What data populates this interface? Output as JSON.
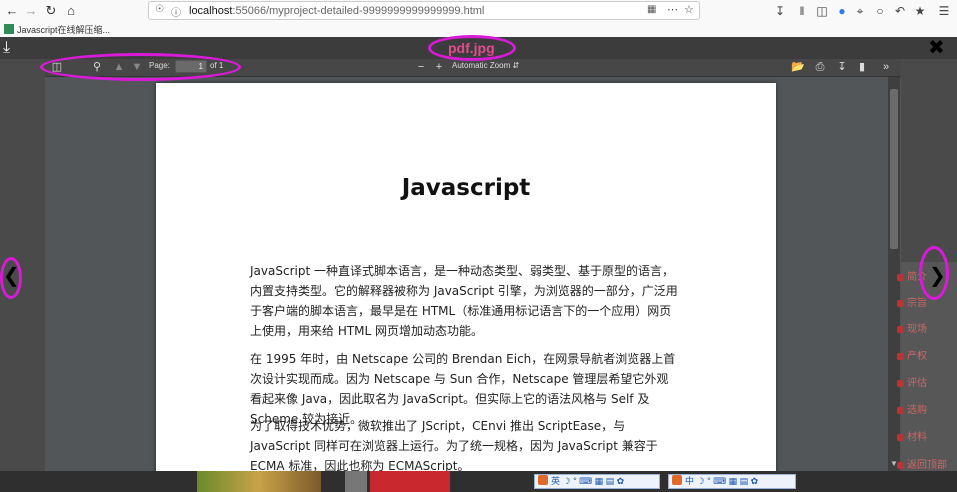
{
  "browser": {
    "url_host": "localhost",
    "url_path": ":55066/myproject-detailed-9999999999999999.html",
    "bookmark": "Javascript在线解压缩..."
  },
  "lightbox": {
    "title": "pdf.jpg",
    "accent_color": "#e34b8f",
    "highlight_color": "#d91bd9"
  },
  "pdf_toolbar": {
    "page_label": "Page:",
    "page_value": "1",
    "page_of": "of 1",
    "zoom_minus": "−",
    "zoom_plus": "+",
    "zoom": "Automatic Zoom",
    "more": "»"
  },
  "document": {
    "title": "Javascript",
    "paragraphs": [
      "JavaScript 一种直译式脚本语言，是一种动态类型、弱类型、基于原型的语言，内置支持类型。它的解释器被称为 JavaScript 引擎，为浏览器的一部分，广泛用于客户端的脚本语言，最早是在 HTML（标准通用标记语言下的一个应用）网页上使用，用来给 HTML 网页增加动态功能。",
      "在 1995 年时，由 Netscape 公司的 Brendan Eich，在网景导航者浏览器上首次设计实现而成。因为 Netscape 与 Sun 合作，Netscape 管理层希望它外观看起来像 Java，因此取名为 JavaScript。但实际上它的语法风格与 Self 及 Scheme 较为接近。",
      "为了取得技术优势，微软推出了 JScript，CEnvi 推出 ScriptEase，与 JavaScript 同样可在浏览器上运行。为了统一规格，因为 JavaScript 兼容于 ECMA 标准，因此也称为 ECMAScript。"
    ]
  },
  "side_panel": {
    "items": [
      "简介",
      "宗旨",
      "现场",
      "产权",
      "评估",
      "选购",
      "材料",
      "返回顶部"
    ]
  },
  "ime": {
    "left": "英",
    "right": "中"
  }
}
